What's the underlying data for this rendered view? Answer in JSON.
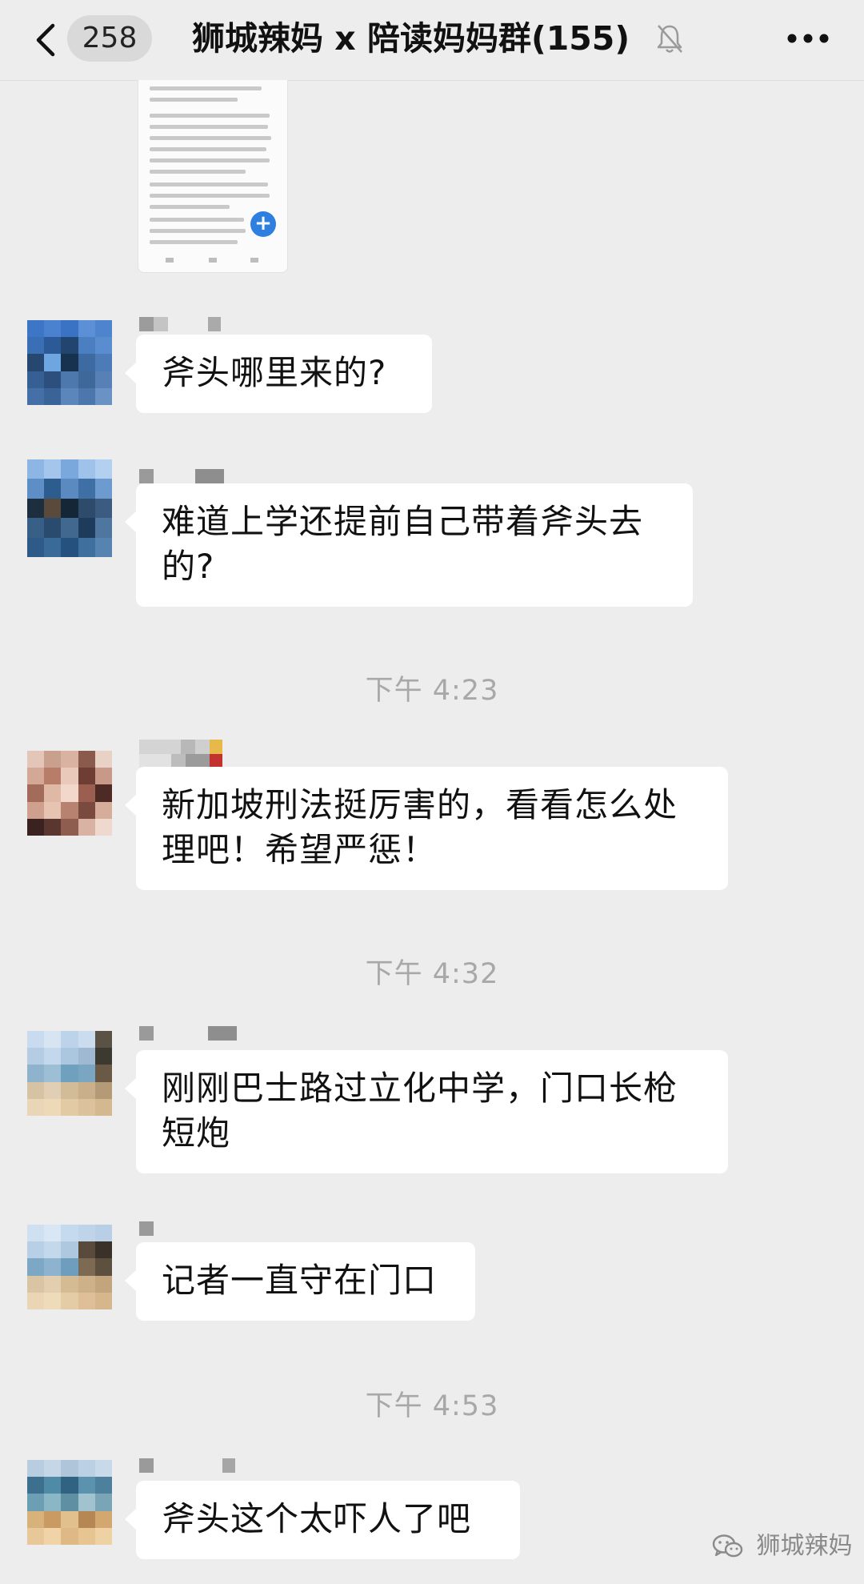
{
  "header": {
    "unread_count": "258",
    "title": "狮城辣妈 x 陪读妈妈群(155)"
  },
  "messages": [
    {
      "text": "斧头哪里来的?"
    },
    {
      "text": "难道上学还提前自己带着斧头去的?"
    },
    {
      "text": "新加坡刑法挺厉害的，看看怎么处理吧！希望严惩！"
    },
    {
      "text": "刚刚巴士路过立化中学，门口长枪短炮"
    },
    {
      "text": "记者一直守在门口"
    },
    {
      "text": "斧头这个太吓人了吧"
    }
  ],
  "timestamps": [
    "下午 4:23",
    "下午 4:32",
    "下午 4:53"
  ],
  "watermark": {
    "text": "狮城辣妈"
  },
  "colors": {
    "background": "#ededed",
    "bubble": "#ffffff",
    "timestamp": "#a8a8a8",
    "accent": "#2f7fe0"
  },
  "icons": [
    "back-icon",
    "mute-bell-icon",
    "more-icon",
    "wechat-icon"
  ]
}
